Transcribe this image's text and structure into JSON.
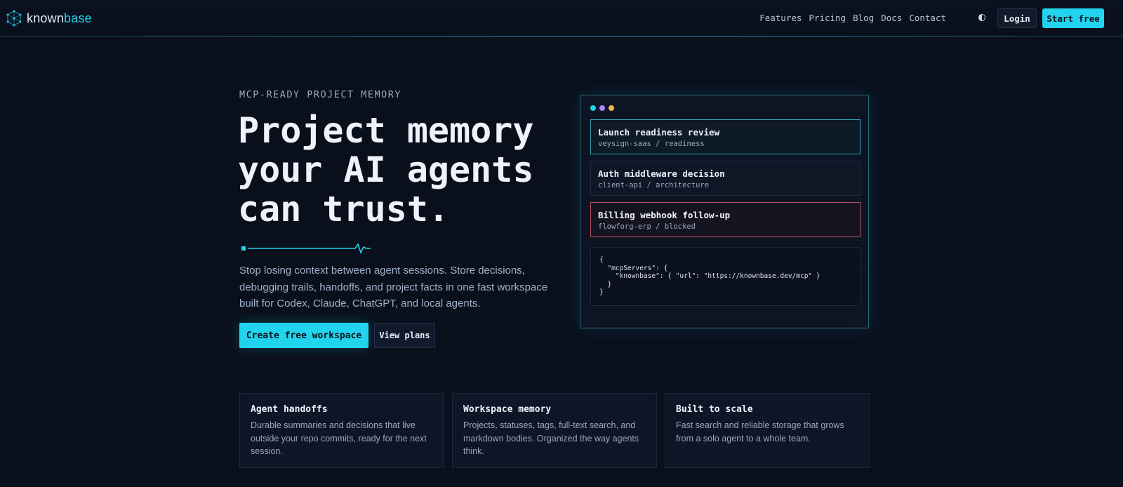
{
  "brand": {
    "name_prefix": "known",
    "name_accent": "base",
    "accent": "#22d3ee"
  },
  "nav": {
    "links": [
      "Features",
      "Pricing",
      "Blog",
      "Docs",
      "Contact"
    ],
    "theme_icon": "half-circle-icon",
    "login_label": "Login",
    "start_label": "Start free"
  },
  "hero": {
    "eyebrow": "MCP-READY PROJECT MEMORY",
    "title_lines": [
      "Project memory",
      "your AI agents",
      "can trust."
    ],
    "description": "Stop losing context between agent sessions. Store decisions, debugging trails, handoffs, and project facts in one fast workspace built for Codex, Claude, ChatGPT, and local agents.",
    "primary_cta": "Create free workspace",
    "secondary_cta": "View plans"
  },
  "panel": {
    "dot_colors": [
      "#22d3ee",
      "#a78bfa",
      "#f5b94a"
    ],
    "cards": [
      {
        "title": "Launch readiness review",
        "sub": "veysign-saas / readiness",
        "state": "active"
      },
      {
        "title": "Auth middleware decision",
        "sub": "client-api / architecture",
        "state": "normal"
      },
      {
        "title": "Billing webhook follow-up",
        "sub": "flowforg-erp / blocked",
        "state": "blocked"
      }
    ],
    "code": "{\n  \"mcpServers\": {\n    \"knownbase\": { \"url\": \"https://knownbase.dev/mcp\" }\n  }\n}"
  },
  "features": [
    {
      "title": "Agent handoffs",
      "desc": "Durable summaries and decisions that live outside your repo commits, ready for the next session."
    },
    {
      "title": "Workspace memory",
      "desc": "Projects, statuses, tags, full-text search, and markdown bodies. Organized the way agents think."
    },
    {
      "title": "Built to scale",
      "desc": "Fast search and reliable storage that grows from a solo agent to a whole team."
    }
  ]
}
